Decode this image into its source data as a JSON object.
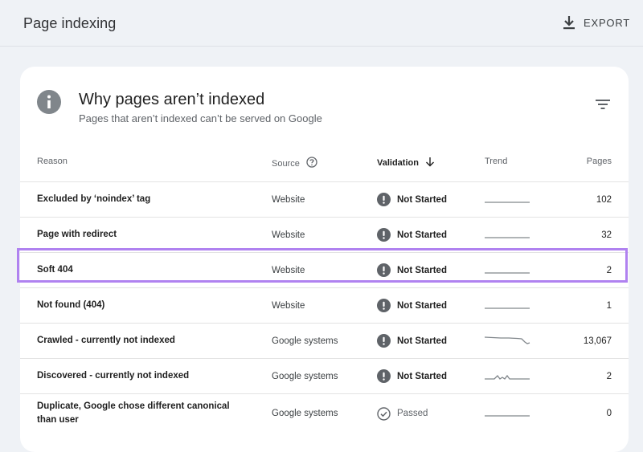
{
  "header": {
    "title": "Page indexing",
    "export_label": "EXPORT"
  },
  "card": {
    "title": "Why pages aren’t indexed",
    "subtitle": "Pages that aren’t indexed can’t be served on Google"
  },
  "columns": {
    "reason": "Reason",
    "source": "Source",
    "validation": "Validation",
    "trend": "Trend",
    "pages": "Pages"
  },
  "rows": [
    {
      "reason": "Excluded by ‘noindex’ tag",
      "source": "Website",
      "validation": "Not Started",
      "status": "not-started",
      "trend": "flat",
      "pages": "102"
    },
    {
      "reason": "Page with redirect",
      "source": "Website",
      "validation": "Not Started",
      "status": "not-started",
      "trend": "flat",
      "pages": "32"
    },
    {
      "reason": "Soft 404",
      "source": "Website",
      "validation": "Not Started",
      "status": "not-started",
      "trend": "flat",
      "pages": "2",
      "highlighted": true
    },
    {
      "reason": "Not found (404)",
      "source": "Website",
      "validation": "Not Started",
      "status": "not-started",
      "trend": "flat",
      "pages": "1"
    },
    {
      "reason": "Crawled - currently not indexed",
      "source": "Google systems",
      "validation": "Not Started",
      "status": "not-started",
      "trend": "declining",
      "pages": "13,067"
    },
    {
      "reason": "Discovered - currently not indexed",
      "source": "Google systems",
      "validation": "Not Started",
      "status": "not-started",
      "trend": "spiky",
      "pages": "2"
    },
    {
      "reason": "Duplicate, Google chose different canonical than user",
      "source": "Google systems",
      "validation": "Passed",
      "status": "passed",
      "trend": "flat",
      "pages": "0"
    }
  ],
  "colors": {
    "background": "#eff2f6",
    "highlight": "#b082f0",
    "status_icon": "#5f6368",
    "trend_line": "#80868b"
  },
  "icons": {
    "export": "download-icon",
    "info": "info-icon",
    "filter": "filter-icon",
    "source_help": "help-icon",
    "sort": "arrow-down-icon",
    "not_started": "exclamation-icon",
    "passed": "check-circle-icon"
  }
}
